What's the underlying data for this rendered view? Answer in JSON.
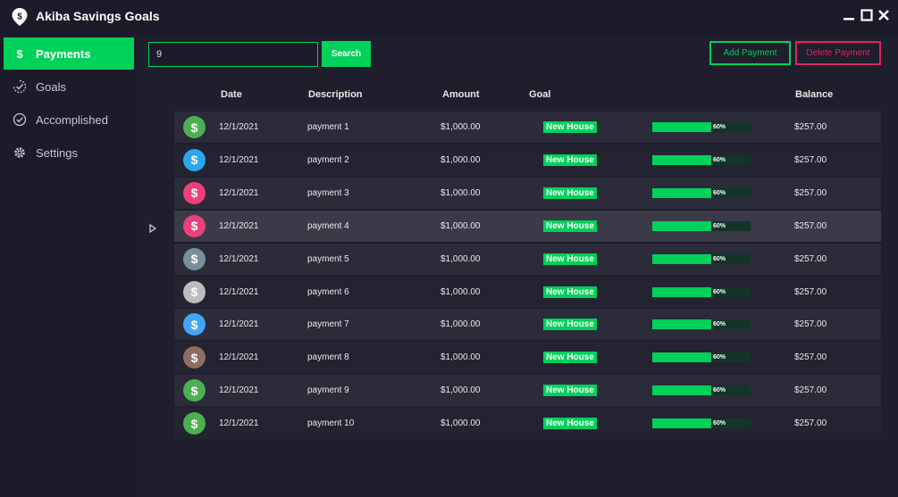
{
  "app": {
    "title": "Akiba Savings Goals"
  },
  "sidebar": {
    "items": [
      {
        "label": "Payments",
        "icon": "dollar-icon",
        "active": true
      },
      {
        "label": "Goals",
        "icon": "goals-icon",
        "active": false
      },
      {
        "label": "Accomplished",
        "icon": "check-circle-icon",
        "active": false
      },
      {
        "label": "Settings",
        "icon": "gear-icon",
        "active": false
      }
    ]
  },
  "toolbar": {
    "search_value": "9",
    "search_label": "Search",
    "add_label": "Add Payment",
    "delete_label": "Delete Payment"
  },
  "table": {
    "headers": {
      "date": "Date",
      "description": "Description",
      "amount": "Amount",
      "goal": "Goal",
      "balance": "Balance"
    },
    "selected_row": 3,
    "rows": [
      {
        "avatar_color": "#4caf50",
        "date": "12/1/2021",
        "description": "payment 1",
        "amount": "$1,000.00",
        "goal": "New House",
        "progress": 60,
        "progress_label": "60%",
        "balance": "$257.00"
      },
      {
        "avatar_color": "#29a8f0",
        "date": "12/1/2021",
        "description": "payment 2",
        "amount": "$1,000.00",
        "goal": "New House",
        "progress": 60,
        "progress_label": "60%",
        "balance": "$257.00"
      },
      {
        "avatar_color": "#ec407a",
        "date": "12/1/2021",
        "description": "payment 3",
        "amount": "$1,000.00",
        "goal": "New House",
        "progress": 60,
        "progress_label": "60%",
        "balance": "$257.00"
      },
      {
        "avatar_color": "#ec407a",
        "date": "12/1/2021",
        "description": "payment 4",
        "amount": "$1,000.00",
        "goal": "New House",
        "progress": 60,
        "progress_label": "60%",
        "balance": "$257.00"
      },
      {
        "avatar_color": "#78909c",
        "date": "12/1/2021",
        "description": "payment 5",
        "amount": "$1,000.00",
        "goal": "New House",
        "progress": 60,
        "progress_label": "60%",
        "balance": "$257.00"
      },
      {
        "avatar_color": "#bdbdbd",
        "date": "12/1/2021",
        "description": "payment 6",
        "amount": "$1,000.00",
        "goal": "New House",
        "progress": 60,
        "progress_label": "60%",
        "balance": "$257.00"
      },
      {
        "avatar_color": "#42a5f5",
        "date": "12/1/2021",
        "description": "payment 7",
        "amount": "$1,000.00",
        "goal": "New House",
        "progress": 60,
        "progress_label": "60%",
        "balance": "$257.00"
      },
      {
        "avatar_color": "#8d6e63",
        "date": "12/1/2021",
        "description": "payment 8",
        "amount": "$1,000.00",
        "goal": "New House",
        "progress": 60,
        "progress_label": "60%",
        "balance": "$257.00"
      },
      {
        "avatar_color": "#4caf50",
        "date": "12/1/2021",
        "description": "payment 9",
        "amount": "$1,000.00",
        "goal": "New House",
        "progress": 60,
        "progress_label": "60%",
        "balance": "$257.00"
      },
      {
        "avatar_color": "#4caf50",
        "date": "12/1/2021",
        "description": "payment 10",
        "amount": "$1,000.00",
        "goal": "New House",
        "progress": 60,
        "progress_label": "60%",
        "balance": "$257.00"
      }
    ]
  },
  "colors": {
    "accent": "#00d15a",
    "danger": "#e0245e",
    "background": "#1b1b29"
  }
}
